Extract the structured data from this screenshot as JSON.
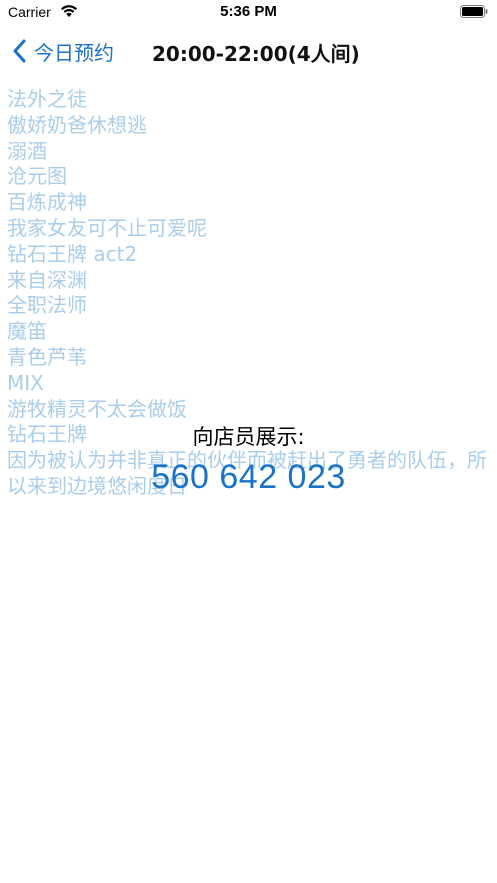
{
  "status_bar": {
    "carrier": "Carrier",
    "time": "5:36 PM",
    "icons": [
      "wifi-icon",
      "battery-icon"
    ]
  },
  "nav": {
    "back_label": "今日预约",
    "title": "20:00-22:00(4人间)"
  },
  "titles": [
    "法外之徒",
    "傲娇奶爸休想逃",
    "溺酒",
    "沧元图",
    "百炼成神",
    "我家女友可不止可爱呢",
    "钻石王牌 act2",
    "来自深渊",
    "全职法师",
    "魔笛",
    "青色芦苇",
    "MIX",
    "游牧精灵不太会做饭",
    "钻石王牌",
    "因为被认为并非真正的伙伴而被赶出了勇者的队伍，所以来到边境悠闲度日"
  ],
  "overlay": {
    "label": "向店员展示:",
    "code": "560 642 023"
  },
  "colors": {
    "accent": "#1a73c8",
    "list_text": "#a9cdea"
  }
}
